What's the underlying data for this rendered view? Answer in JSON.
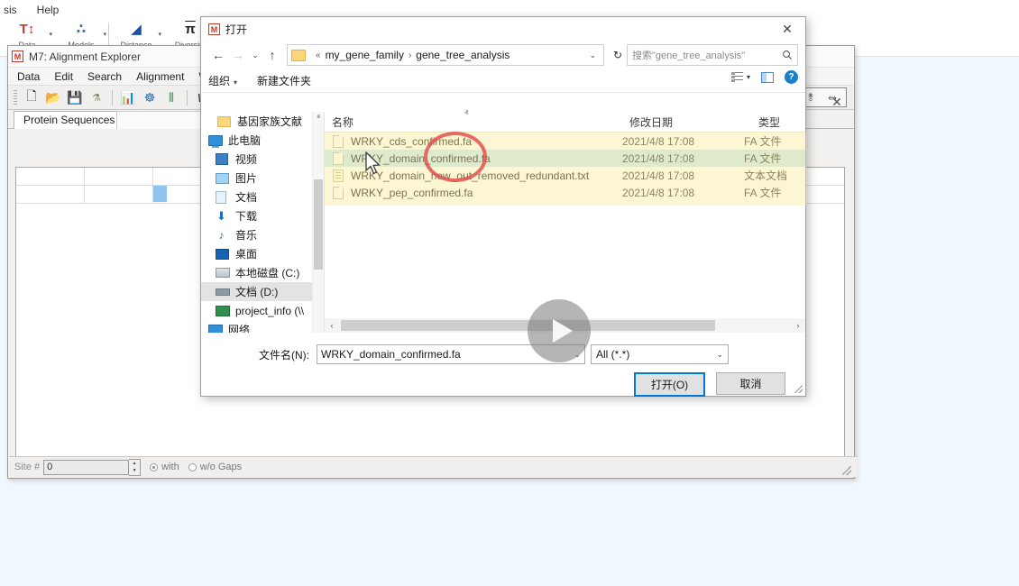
{
  "mega_main": {
    "menu": [
      "sis",
      "Help"
    ],
    "toolbar": [
      {
        "icon": "data-icon",
        "glyph": "T↕",
        "label": "Data",
        "color": "#c0392b"
      },
      {
        "icon": "models-icon",
        "glyph": "∴",
        "label": "Models",
        "color": "#2f6fad"
      },
      {
        "icon": "distance-icon",
        "glyph": "◢",
        "label": "Distance",
        "color": "#1f4ea1"
      },
      {
        "icon": "diversity-icon",
        "glyph": "π",
        "label": "Diversity",
        "color": "#222222"
      }
    ]
  },
  "align_win": {
    "logo": "M",
    "title": "M7: Alignment Explorer",
    "close_label": "✕",
    "menu": [
      "Data",
      "Edit",
      "Search",
      "Alignment",
      "Web"
    ],
    "toolbar_icons": [
      {
        "name": "new-file-icon",
        "glyph": "🗋"
      },
      {
        "name": "open-folder-icon",
        "glyph": "📂"
      },
      {
        "name": "save-icon",
        "glyph": "💾"
      },
      {
        "name": "dna-icon",
        "glyph": "⚗"
      },
      {
        "name": "align-muscle-icon",
        "glyph": "📊"
      },
      {
        "name": "clustal-icon",
        "glyph": "☸"
      },
      {
        "name": "barcode-icon",
        "glyph": "⦀"
      },
      {
        "name": "translate-w-icon",
        "glyph": "W"
      }
    ],
    "right_icons": [
      {
        "name": "sequence-tool-1-icon",
        "glyph": "⥉"
      },
      {
        "name": "sequence-tool-2-icon",
        "glyph": "⥈"
      }
    ],
    "tab_label": "Protein Sequences",
    "status": {
      "site_label": "Site #",
      "site_value": "0",
      "with_label": "with",
      "without_label": "w/o Gaps"
    }
  },
  "dialog": {
    "logo": "M",
    "title": "打开",
    "close_label": "✕",
    "nav": {
      "back": "←",
      "forward": "→",
      "history": "⌄",
      "up": "↑",
      "refresh": "↻",
      "crumb_prefix": "«",
      "crumbs": [
        "my_gene_family",
        "gene_tree_analysis"
      ],
      "crumb_sep": "›",
      "crumb_caret": "⌄"
    },
    "search": {
      "placeholder": "搜索\"gene_tree_analysis\"",
      "icon": "search-icon"
    },
    "commands": {
      "organize": "组织",
      "organize_caret": "▾",
      "new_folder": "新建文件夹",
      "view_caret": "▾"
    },
    "nav_pane": [
      {
        "label": "基因家族文献",
        "icon": "folder-icon",
        "icon_class": "ic-folder",
        "indent": 18,
        "selected": false
      },
      {
        "label": "此电脑",
        "icon": "this-pc-icon",
        "icon_class": "ic-pc",
        "indent": 8,
        "selected": false
      },
      {
        "label": "视频",
        "icon": "videos-icon",
        "icon_class": "ic-video",
        "indent": 18,
        "selected": false
      },
      {
        "label": "图片",
        "icon": "pictures-icon",
        "icon_class": "ic-pic",
        "indent": 18,
        "selected": false
      },
      {
        "label": "文档",
        "icon": "documents-icon",
        "icon_class": "ic-doc",
        "indent": 18,
        "selected": false
      },
      {
        "label": "下载",
        "icon": "downloads-icon",
        "icon_class": "ic-dl",
        "indent": 18,
        "selected": false,
        "glyph": "⬇"
      },
      {
        "label": "音乐",
        "icon": "music-icon",
        "icon_class": "ic-music",
        "indent": 18,
        "selected": false,
        "glyph": "♪"
      },
      {
        "label": "桌面",
        "icon": "desktop-icon",
        "icon_class": "ic-desk",
        "indent": 18,
        "selected": false
      },
      {
        "label": "本地磁盘 (C:)",
        "icon": "local-disk-c-icon",
        "icon_class": "ic-drive",
        "indent": 18,
        "selected": false
      },
      {
        "label": "文档 (D:)",
        "icon": "documents-d-icon",
        "icon_class": "ic-drive-d",
        "indent": 18,
        "selected": true
      },
      {
        "label": "project_info (\\\\",
        "icon": "network-drive-icon",
        "icon_class": "ic-net",
        "indent": 18,
        "selected": false
      },
      {
        "label": "网络",
        "icon": "network-icon",
        "icon_class": "ic-netblue",
        "indent": 8,
        "selected": false
      }
    ],
    "nav_scrollbar": {
      "up": "ⱏ",
      "down": "ⱟ"
    },
    "list_columns": [
      "名称",
      "修改日期",
      "类型"
    ],
    "sort_mark": "ⱏ",
    "files": [
      {
        "name": "WRKY_cds_confirmed.fa",
        "date": "2021/4/8 17:08",
        "type": "FA 文件",
        "icon": "fa-file-icon",
        "icon_class": "fi-fa",
        "selected": false
      },
      {
        "name": "WRKY_domain_confirmed.fa",
        "date": "2021/4/8 17:08",
        "type": "FA 文件",
        "icon": "fa-file-icon",
        "icon_class": "fi-fa",
        "selected": true
      },
      {
        "name": "WRKY_domain_new_out_removed_redundant.txt",
        "date": "2021/4/8 17:08",
        "type": "文本文档",
        "icon": "text-file-icon",
        "icon_class": "fi-txt",
        "selected": false
      },
      {
        "name": "WRKY_pep_confirmed.fa",
        "date": "2021/4/8 17:08",
        "type": "FA 文件",
        "icon": "fa-file-icon",
        "icon_class": "fi-fa",
        "selected": false
      }
    ],
    "hscroll": {
      "left": "‹",
      "right": "›"
    },
    "footer": {
      "filename_label": "文件名(N):",
      "filename_value": "WRKY_domain_confirmed.fa",
      "filename_caret": "⌄",
      "filter_value": "All (*.*)",
      "filter_caret": "⌄",
      "open_button": "打开(O)",
      "cancel_button": "取消"
    }
  },
  "overlays": {
    "annotation_color": "#e24c4c",
    "play_button": "play-overlay-icon",
    "cursor": "mouse-cursor"
  },
  "theme": {
    "desktop_bg": "#f0f7fd",
    "selection_blue": "#cde8f7",
    "accent_blue": "#0078d7",
    "highlight_yellow": "#f7ec94"
  }
}
